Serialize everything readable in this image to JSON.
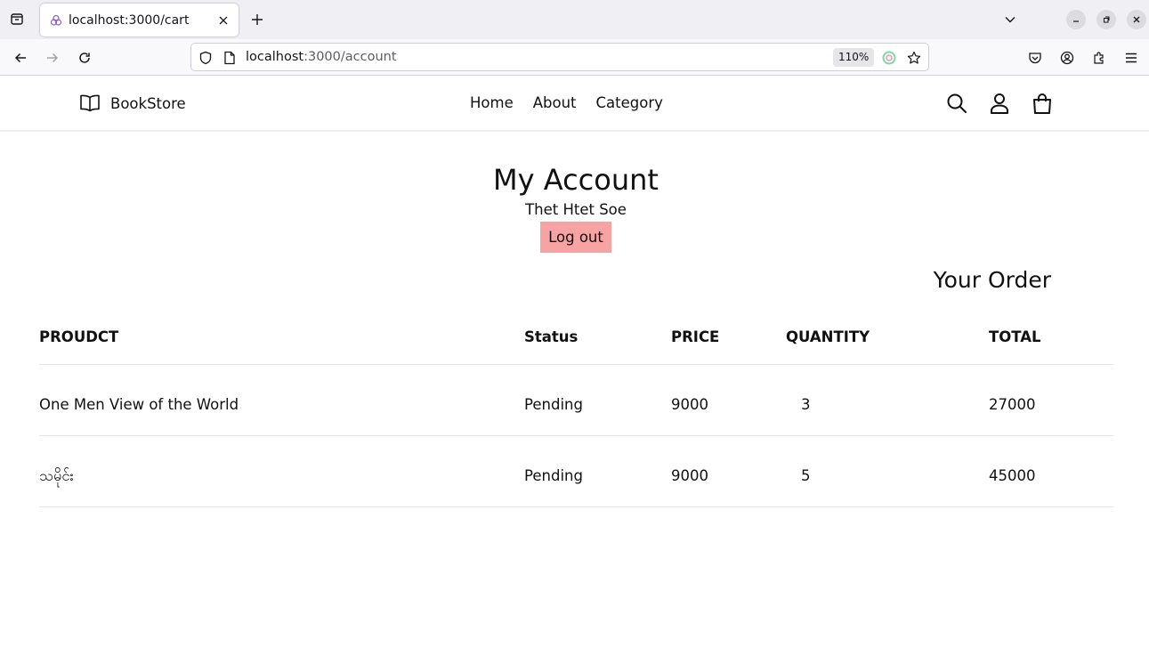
{
  "browser": {
    "tab_title": "localhost:3000/cart",
    "url_host": "localhost",
    "url_path": ":3000/account",
    "zoom": "110%"
  },
  "site": {
    "brand": "BookStore",
    "nav": [
      "Home",
      "About",
      "Category"
    ]
  },
  "account": {
    "title": "My Account",
    "user_name": "Thet Htet Soe",
    "logout_label": "Log out",
    "orders_title": "Your Order"
  },
  "orders": {
    "headers": {
      "product": "PROUDCT",
      "status": "Status",
      "price": "PRICE",
      "quantity": "QUANTITY",
      "total": "TOTAL"
    },
    "rows": [
      {
        "product": "One Men View of the World",
        "status": "Pending",
        "price": "9000",
        "quantity": "3",
        "total": "27000"
      },
      {
        "product": "သမိုင်း",
        "status": "Pending",
        "price": "9000",
        "quantity": "5",
        "total": "45000"
      }
    ]
  }
}
